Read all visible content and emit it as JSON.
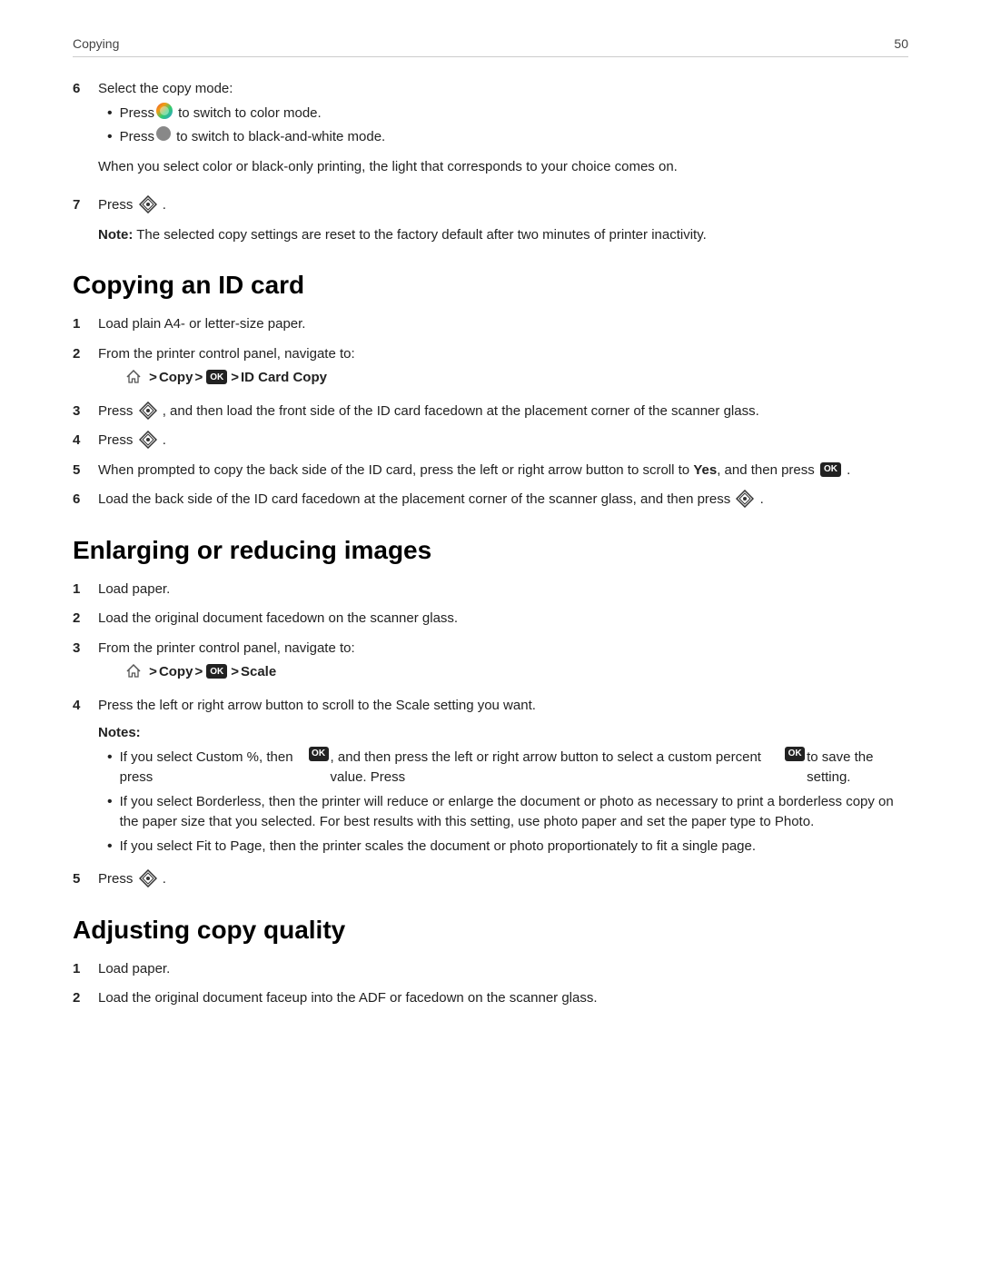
{
  "header": {
    "section": "Copying",
    "page": "50"
  },
  "step6_intro": "Select the copy mode:",
  "step6_bullets": [
    "Press  to switch to color mode.",
    "Press  to switch to black-and-white mode."
  ],
  "step6_note": "When you select color or black-only printing, the light that corresponds to your choice comes on.",
  "step7": "Press",
  "note_text": "The selected copy settings are reset to the factory default after two minutes of printer inactivity.",
  "section_id_card": {
    "heading": "Copying an ID card",
    "steps": [
      "Load plain A4- or letter-size paper.",
      "From the printer control panel, navigate to:",
      "",
      "Press  , and then load the front side of the ID card facedown at the placement corner of the scanner glass.",
      "Press",
      "When prompted to copy the back side of the ID card, press the left or right arrow button to scroll to Yes, and then press  .",
      "Load the back side of the ID card facedown at the placement corner of the scanner glass, and then press  ."
    ],
    "nav_path": "> Copy >  > ID Card Copy"
  },
  "section_enlarge": {
    "heading": "Enlarging or reducing images",
    "steps": [
      "Load paper.",
      "Load the original document facedown on the scanner glass.",
      "From the printer control panel, navigate to:",
      "",
      "Press the left or right arrow button to scroll to the Scale setting you want.",
      "Press"
    ],
    "nav_path": "> Copy >  > Scale",
    "notes_header": "Notes:",
    "notes": [
      "If you select Custom %, then press  , and then press the left or right arrow button to select a custom percent value. Press  to save the setting.",
      "If you select Borderless, then the printer will reduce or enlarge the document or photo as necessary to print a borderless copy on the paper size that you selected. For best results with this setting, use photo paper and set the paper type to Photo.",
      "If you select Fit to Page, then the printer scales the document or photo proportionately to fit a single page."
    ]
  },
  "section_quality": {
    "heading": "Adjusting copy quality",
    "steps": [
      "Load paper.",
      "Load the original document faceup into the ADF or facedown on the scanner glass."
    ]
  }
}
